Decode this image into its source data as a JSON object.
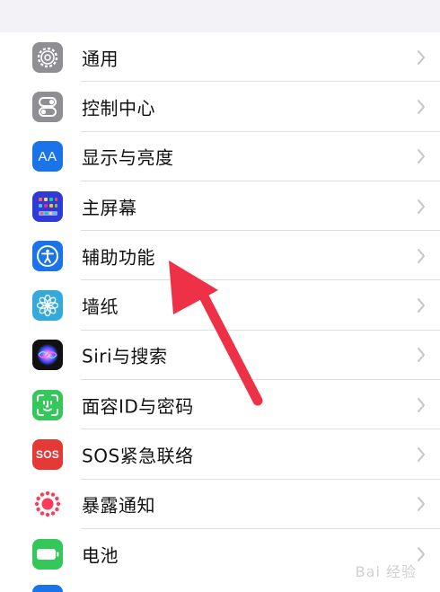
{
  "settings": {
    "items": [
      {
        "label": "通用",
        "icon": "gear-icon",
        "icon_color": "#8e8e93"
      },
      {
        "label": "控制中心",
        "icon": "control-center-icon",
        "icon_color": "#8e8e93"
      },
      {
        "label": "显示与亮度",
        "icon": "display-aa-icon",
        "icon_color": "#1a73e8",
        "icon_text": "AA"
      },
      {
        "label": "主屏幕",
        "icon": "home-screen-icon",
        "icon_color": "#2f3bd9"
      },
      {
        "label": "辅助功能",
        "icon": "accessibility-icon",
        "icon_color": "#1a73e8"
      },
      {
        "label": "墙纸",
        "icon": "wallpaper-flower-icon",
        "icon_color": "#34aadc"
      },
      {
        "label": "Siri与搜索",
        "icon": "siri-icon",
        "icon_color": "#000000"
      },
      {
        "label": "面容ID与密码",
        "icon": "face-id-icon",
        "icon_color": "#34c759"
      },
      {
        "label": "SOS紧急联络",
        "icon": "sos-icon",
        "icon_color": "#e53935",
        "icon_text": "SOS"
      },
      {
        "label": "暴露通知",
        "icon": "exposure-notification-icon",
        "icon_color": "#ffffff"
      },
      {
        "label": "电池",
        "icon": "battery-icon",
        "icon_color": "#34c759"
      }
    ]
  },
  "annotation": {
    "arrow_color": "#ef3147"
  },
  "watermark": {
    "text": "Bai 经验"
  }
}
